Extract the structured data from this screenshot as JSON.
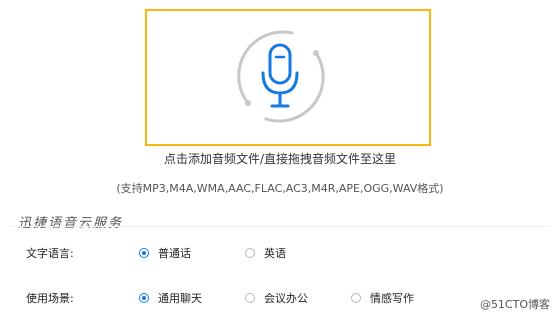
{
  "upload": {
    "primary_text": "点击添加音频文件/直接拖拽音频文件至这里",
    "formats_text": "(支持MP3,M4A,WMA,AAC,FLAC,AC3,M4R,APE,OGG,WAV格式)",
    "icon": "microphone-icon"
  },
  "section": {
    "title": "迅捷语音云服务"
  },
  "language": {
    "label": "文字语言:",
    "options": [
      {
        "label": "普通话",
        "selected": true
      },
      {
        "label": "英语",
        "selected": false
      }
    ]
  },
  "scenario": {
    "label": "使用场景:",
    "options": [
      {
        "label": "通用聊天",
        "selected": true
      },
      {
        "label": "会议办公",
        "selected": false
      },
      {
        "label": "情感写作",
        "selected": false
      }
    ]
  },
  "watermark": "@51CTO博客",
  "colors": {
    "accent": "#1677e5",
    "highlight_border": "#f5b70f",
    "ring": "#c8c8c8"
  }
}
